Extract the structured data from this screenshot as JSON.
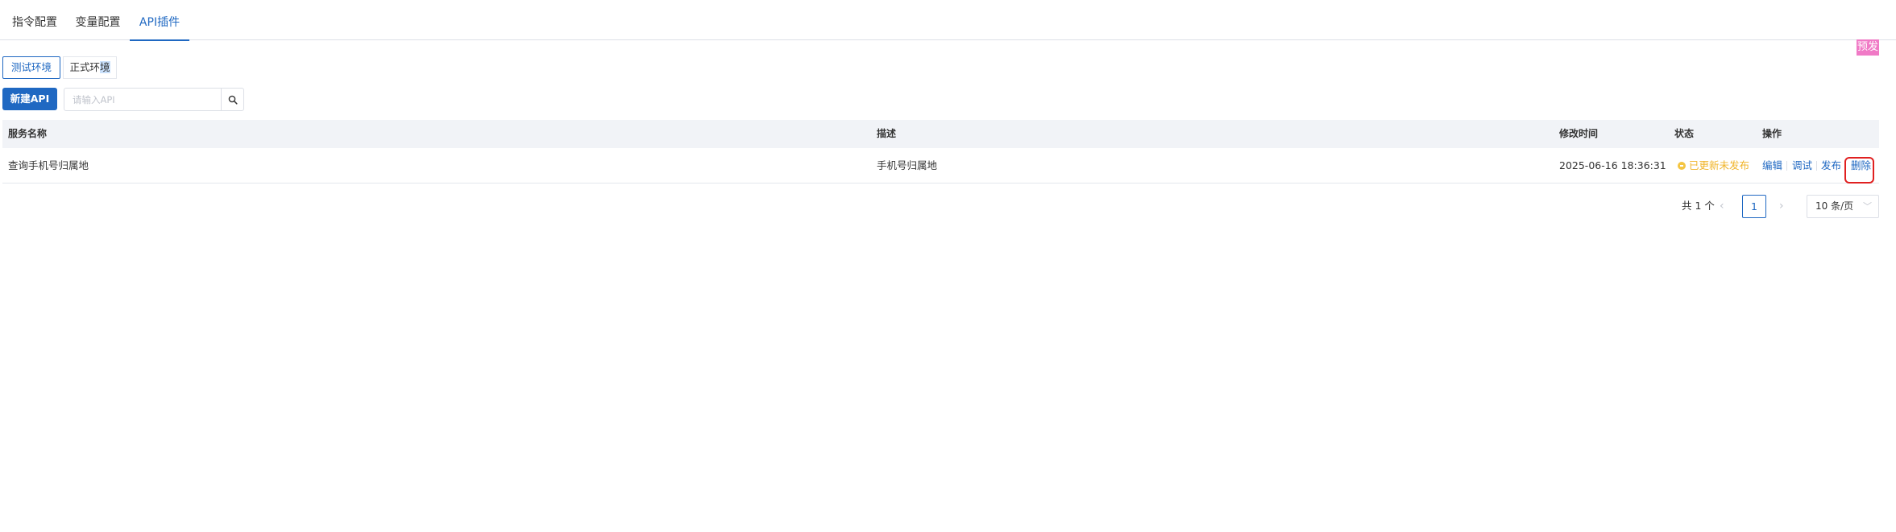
{
  "tabs": [
    {
      "label": "指令配置"
    },
    {
      "label": "变量配置"
    },
    {
      "label": "API插件"
    }
  ],
  "env": {
    "test_label": "测试环境",
    "prod_label_a": "正式环",
    "prod_label_b": "境"
  },
  "badge": {
    "label": "预发"
  },
  "toolbar": {
    "new_label": "新建API",
    "search_placeholder": "请输入API"
  },
  "table": {
    "columns": [
      "服务名称",
      "描述",
      "修改时间",
      "状态",
      "操作"
    ],
    "rows": [
      {
        "name": "查询手机号归属地",
        "desc": "手机号归属地",
        "modified": "2025-06-16 18:36:31",
        "status": "已更新未发布",
        "actions": [
          "编辑",
          "调试",
          "发布",
          "删除"
        ]
      }
    ]
  },
  "pagination": {
    "total": "共 1 个",
    "current_page": "1",
    "page_size": "10 条/页",
    "prev_icon": "chevron-left-icon",
    "next_icon": "chevron-right-icon"
  },
  "colors": {
    "accent": "#1f68c2",
    "status_warning": "#f0b429",
    "badge": "#f07ac6",
    "highlight_box": "#e02020"
  }
}
